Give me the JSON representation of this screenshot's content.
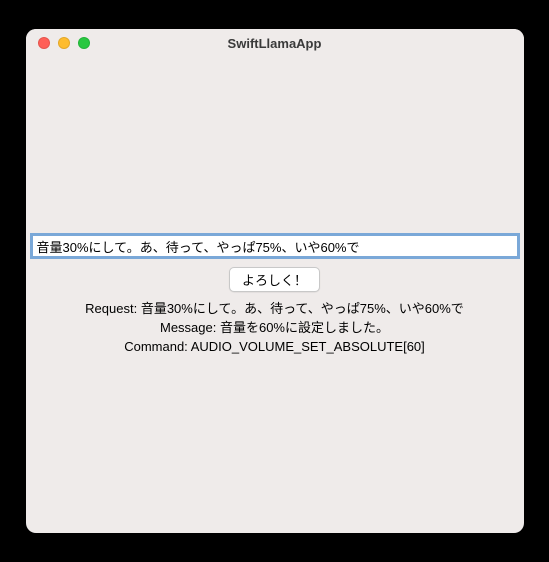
{
  "window": {
    "title": "SwiftLlamaApp"
  },
  "input": {
    "value": "音量30%にして。あ、待って、やっぱ75%、いや60%で"
  },
  "button": {
    "label": "よろしく！"
  },
  "output": {
    "request_label": "Request: ",
    "request_value": "音量30%にして。あ、待って、やっぱ75%、いや60%で",
    "message_label": "Message: ",
    "message_value": "音量を60%に設定しました。",
    "command_label": "Command: ",
    "command_value": "AUDIO_VOLUME_SET_ABSOLUTE[60]"
  }
}
